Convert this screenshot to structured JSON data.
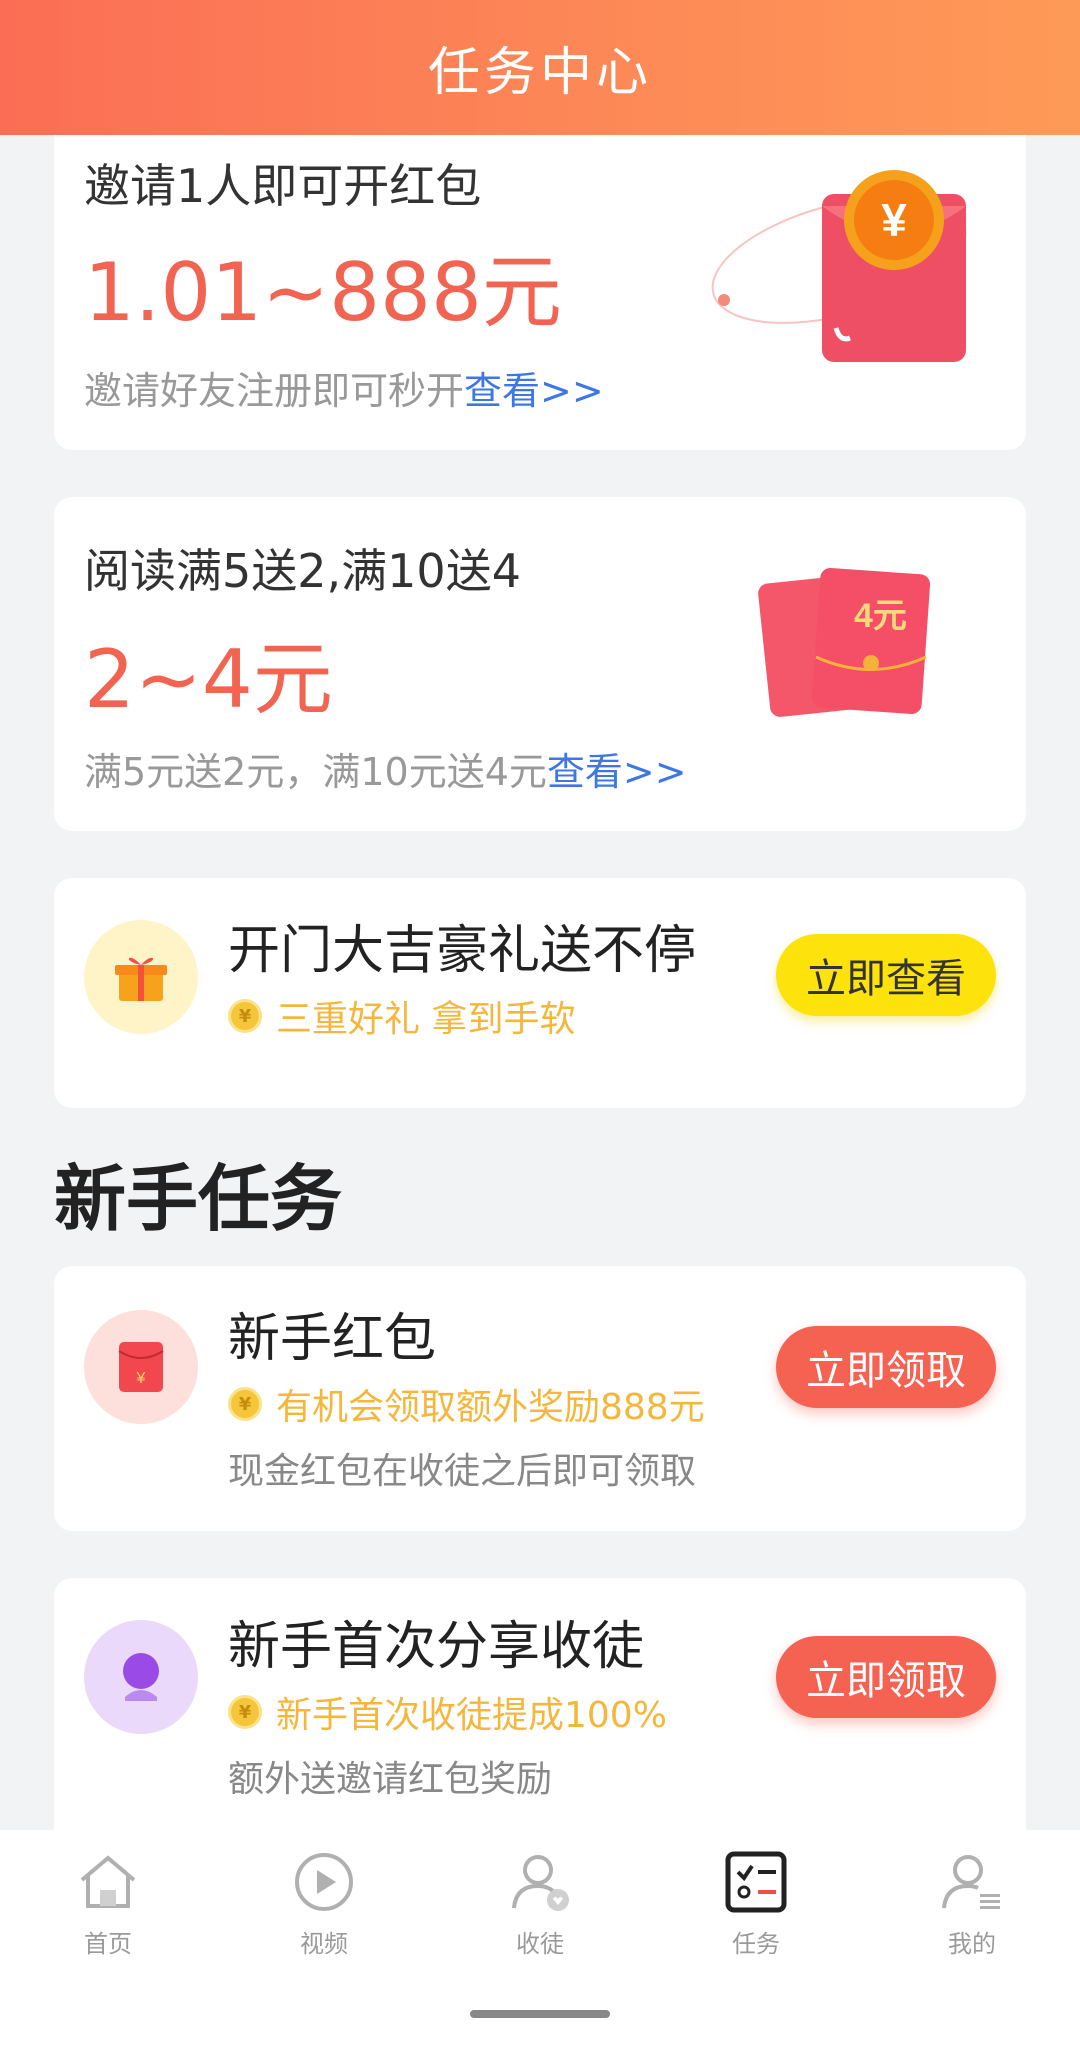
{
  "header": {
    "title": "任务中心"
  },
  "promos": [
    {
      "title": "邀请1人即可开红包",
      "amount": "1.01~888元",
      "desc": "邀请好友注册即可秒开",
      "link": "查看>>"
    },
    {
      "title": "阅读满5送2,满10送4",
      "amount": "2~4元",
      "desc": "满5元送2元，满10元送4元",
      "link": "查看>>",
      "envelope_label": "4元"
    }
  ],
  "featured": {
    "title": "开门大吉豪礼送不停",
    "subtitle": "三重好礼 拿到手软",
    "button": "立即查看"
  },
  "section": {
    "title": "新手任务"
  },
  "tasks": [
    {
      "title": "新手红包",
      "subtitle": "有机会领取额外奖励888元",
      "note": "现金红包在收徒之后即可领取",
      "button": "立即领取"
    },
    {
      "title": "新手首次分享收徒",
      "subtitle": "新手首次收徒提成100%",
      "note": "额外送邀请红包奖励",
      "button": "立即领取"
    }
  ],
  "tabbar": {
    "items": [
      {
        "label": "首页",
        "icon": "home-icon"
      },
      {
        "label": "视频",
        "icon": "play-icon"
      },
      {
        "label": "收徒",
        "icon": "user-heart-icon"
      },
      {
        "label": "任务",
        "icon": "task-list-icon",
        "active": true
      },
      {
        "label": "我的",
        "icon": "user-profile-icon"
      }
    ]
  },
  "colors": {
    "accent": "#f26452",
    "link": "#3e77e4",
    "coin": "#f5b63c",
    "yellow_button": "#fde30b",
    "red_button": "#f56252"
  }
}
